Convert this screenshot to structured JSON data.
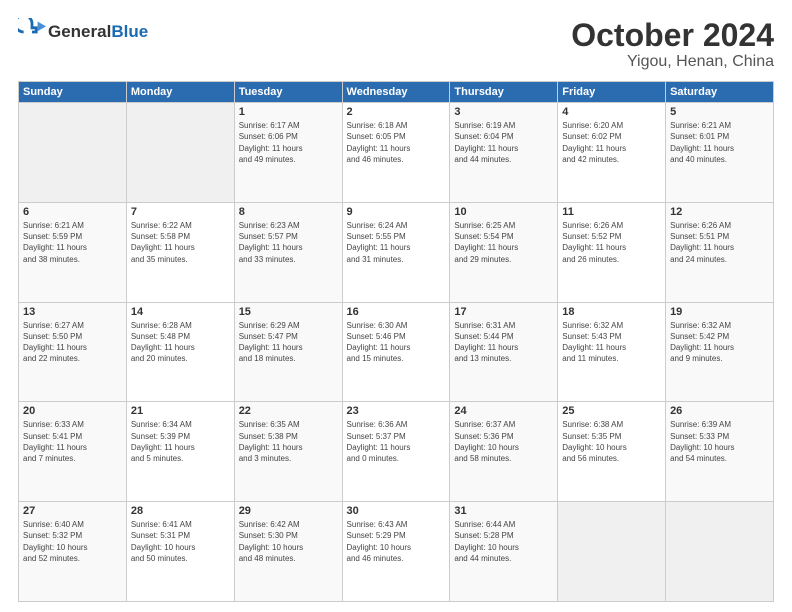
{
  "header": {
    "logo": {
      "general": "General",
      "blue": "Blue"
    },
    "title": "October 2024",
    "location": "Yigou, Henan, China"
  },
  "columns": [
    "Sunday",
    "Monday",
    "Tuesday",
    "Wednesday",
    "Thursday",
    "Friday",
    "Saturday"
  ],
  "weeks": [
    [
      {
        "day": "",
        "detail": ""
      },
      {
        "day": "",
        "detail": ""
      },
      {
        "day": "1",
        "detail": "Sunrise: 6:17 AM\nSunset: 6:06 PM\nDaylight: 11 hours\nand 49 minutes."
      },
      {
        "day": "2",
        "detail": "Sunrise: 6:18 AM\nSunset: 6:05 PM\nDaylight: 11 hours\nand 46 minutes."
      },
      {
        "day": "3",
        "detail": "Sunrise: 6:19 AM\nSunset: 6:04 PM\nDaylight: 11 hours\nand 44 minutes."
      },
      {
        "day": "4",
        "detail": "Sunrise: 6:20 AM\nSunset: 6:02 PM\nDaylight: 11 hours\nand 42 minutes."
      },
      {
        "day": "5",
        "detail": "Sunrise: 6:21 AM\nSunset: 6:01 PM\nDaylight: 11 hours\nand 40 minutes."
      }
    ],
    [
      {
        "day": "6",
        "detail": "Sunrise: 6:21 AM\nSunset: 5:59 PM\nDaylight: 11 hours\nand 38 minutes."
      },
      {
        "day": "7",
        "detail": "Sunrise: 6:22 AM\nSunset: 5:58 PM\nDaylight: 11 hours\nand 35 minutes."
      },
      {
        "day": "8",
        "detail": "Sunrise: 6:23 AM\nSunset: 5:57 PM\nDaylight: 11 hours\nand 33 minutes."
      },
      {
        "day": "9",
        "detail": "Sunrise: 6:24 AM\nSunset: 5:55 PM\nDaylight: 11 hours\nand 31 minutes."
      },
      {
        "day": "10",
        "detail": "Sunrise: 6:25 AM\nSunset: 5:54 PM\nDaylight: 11 hours\nand 29 minutes."
      },
      {
        "day": "11",
        "detail": "Sunrise: 6:26 AM\nSunset: 5:52 PM\nDaylight: 11 hours\nand 26 minutes."
      },
      {
        "day": "12",
        "detail": "Sunrise: 6:26 AM\nSunset: 5:51 PM\nDaylight: 11 hours\nand 24 minutes."
      }
    ],
    [
      {
        "day": "13",
        "detail": "Sunrise: 6:27 AM\nSunset: 5:50 PM\nDaylight: 11 hours\nand 22 minutes."
      },
      {
        "day": "14",
        "detail": "Sunrise: 6:28 AM\nSunset: 5:48 PM\nDaylight: 11 hours\nand 20 minutes."
      },
      {
        "day": "15",
        "detail": "Sunrise: 6:29 AM\nSunset: 5:47 PM\nDaylight: 11 hours\nand 18 minutes."
      },
      {
        "day": "16",
        "detail": "Sunrise: 6:30 AM\nSunset: 5:46 PM\nDaylight: 11 hours\nand 15 minutes."
      },
      {
        "day": "17",
        "detail": "Sunrise: 6:31 AM\nSunset: 5:44 PM\nDaylight: 11 hours\nand 13 minutes."
      },
      {
        "day": "18",
        "detail": "Sunrise: 6:32 AM\nSunset: 5:43 PM\nDaylight: 11 hours\nand 11 minutes."
      },
      {
        "day": "19",
        "detail": "Sunrise: 6:32 AM\nSunset: 5:42 PM\nDaylight: 11 hours\nand 9 minutes."
      }
    ],
    [
      {
        "day": "20",
        "detail": "Sunrise: 6:33 AM\nSunset: 5:41 PM\nDaylight: 11 hours\nand 7 minutes."
      },
      {
        "day": "21",
        "detail": "Sunrise: 6:34 AM\nSunset: 5:39 PM\nDaylight: 11 hours\nand 5 minutes."
      },
      {
        "day": "22",
        "detail": "Sunrise: 6:35 AM\nSunset: 5:38 PM\nDaylight: 11 hours\nand 3 minutes."
      },
      {
        "day": "23",
        "detail": "Sunrise: 6:36 AM\nSunset: 5:37 PM\nDaylight: 11 hours\nand 0 minutes."
      },
      {
        "day": "24",
        "detail": "Sunrise: 6:37 AM\nSunset: 5:36 PM\nDaylight: 10 hours\nand 58 minutes."
      },
      {
        "day": "25",
        "detail": "Sunrise: 6:38 AM\nSunset: 5:35 PM\nDaylight: 10 hours\nand 56 minutes."
      },
      {
        "day": "26",
        "detail": "Sunrise: 6:39 AM\nSunset: 5:33 PM\nDaylight: 10 hours\nand 54 minutes."
      }
    ],
    [
      {
        "day": "27",
        "detail": "Sunrise: 6:40 AM\nSunset: 5:32 PM\nDaylight: 10 hours\nand 52 minutes."
      },
      {
        "day": "28",
        "detail": "Sunrise: 6:41 AM\nSunset: 5:31 PM\nDaylight: 10 hours\nand 50 minutes."
      },
      {
        "day": "29",
        "detail": "Sunrise: 6:42 AM\nSunset: 5:30 PM\nDaylight: 10 hours\nand 48 minutes."
      },
      {
        "day": "30",
        "detail": "Sunrise: 6:43 AM\nSunset: 5:29 PM\nDaylight: 10 hours\nand 46 minutes."
      },
      {
        "day": "31",
        "detail": "Sunrise: 6:44 AM\nSunset: 5:28 PM\nDaylight: 10 hours\nand 44 minutes."
      },
      {
        "day": "",
        "detail": ""
      },
      {
        "day": "",
        "detail": ""
      }
    ]
  ]
}
